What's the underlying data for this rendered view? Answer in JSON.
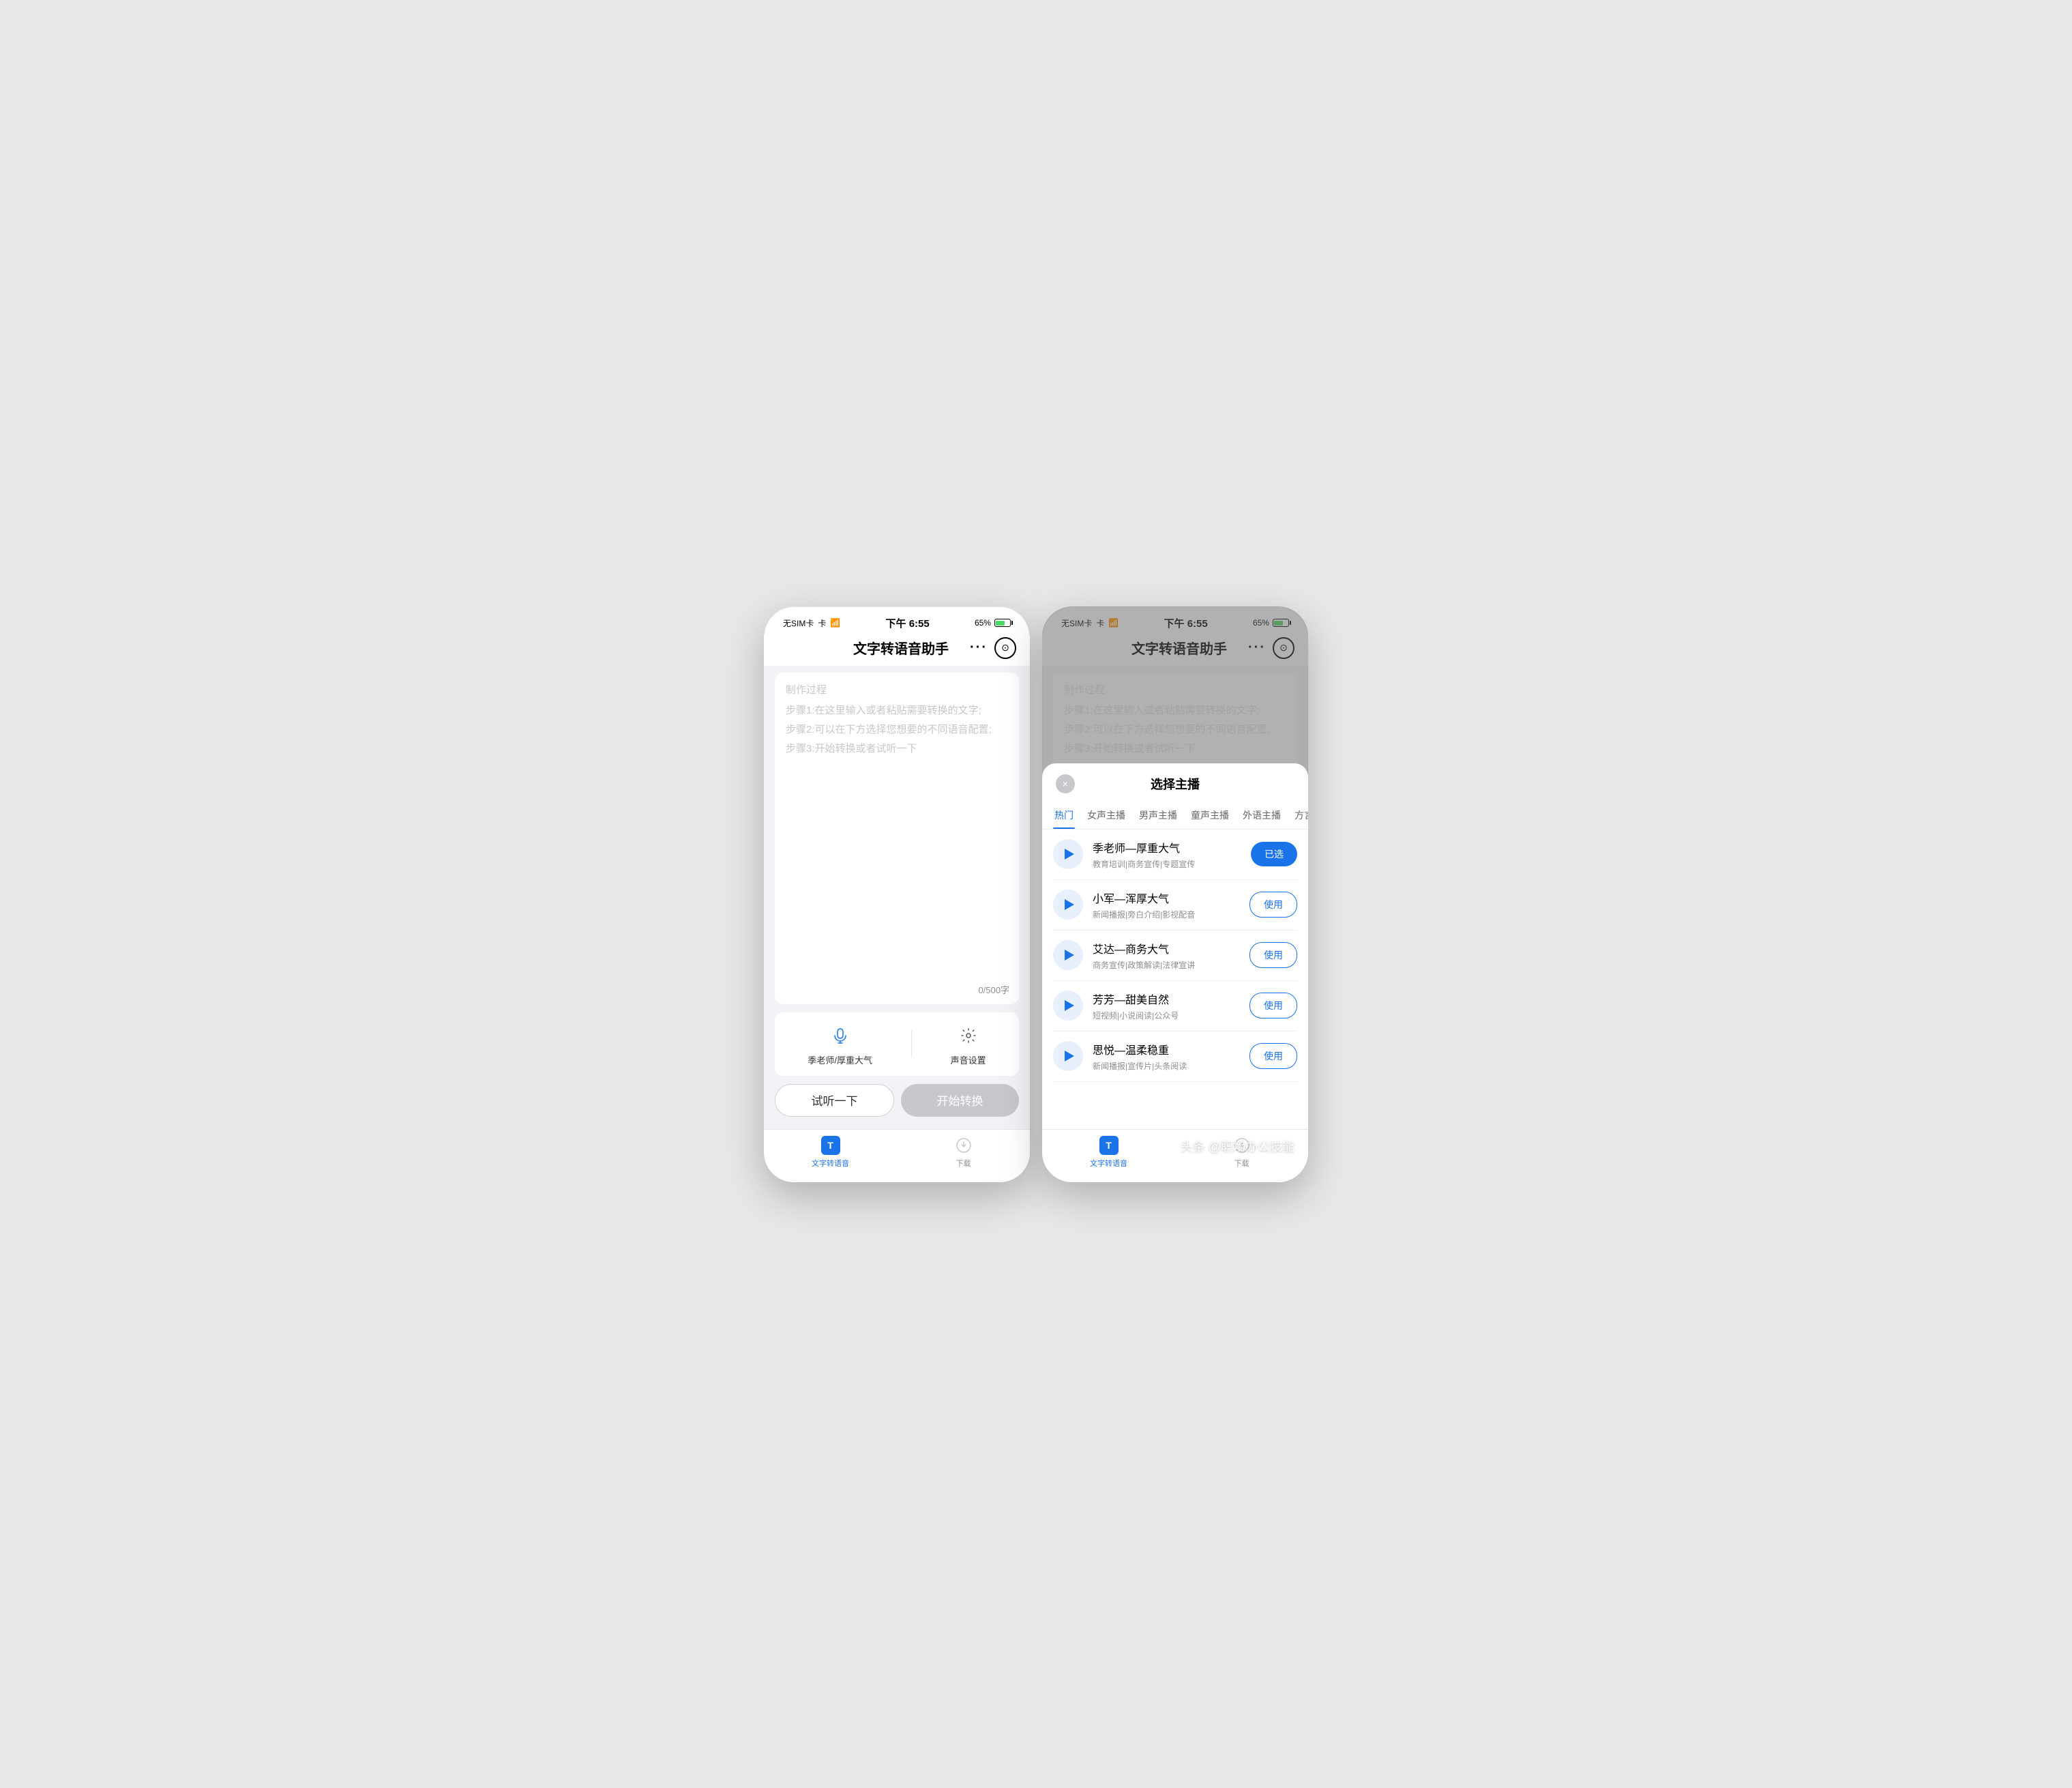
{
  "statusBar": {
    "carrier": "无SIM卡",
    "wifi": "wifi",
    "time": "下午 6:55",
    "battery": "65%"
  },
  "leftPhone": {
    "navTitle": "文字转语音助手",
    "dotsBtnLabel": "···",
    "placeholder": {
      "title": "制作过程",
      "step1": "步骤1:在这里输入或者粘贴需要转换的文字;",
      "step2": "步骤2:可以在下方选择您想要的不同语音配置;",
      "step3": "步骤3:开始转换或者试听一下"
    },
    "charCount": "0/500字",
    "voiceSelector": {
      "label": "季老师/厚重大气",
      "icon": "mic"
    },
    "settingsBtn": {
      "label": "声音设置",
      "icon": "gear"
    },
    "previewBtn": "试听一下",
    "convertBtn": "开始转换",
    "tabs": [
      {
        "id": "tts",
        "label": "文字转语音",
        "active": true
      },
      {
        "id": "download",
        "label": "下载",
        "active": false
      }
    ]
  },
  "rightPhone": {
    "navTitle": "文字转语音助手",
    "dotsBtnLabel": "···",
    "modal": {
      "title": "选择主播",
      "closeBtn": "×",
      "categories": [
        {
          "id": "hot",
          "label": "热门",
          "active": true
        },
        {
          "id": "female",
          "label": "女声主播",
          "active": false
        },
        {
          "id": "male",
          "label": "男声主播",
          "active": false
        },
        {
          "id": "child",
          "label": "童声主播",
          "active": false
        },
        {
          "id": "foreign",
          "label": "外语主播",
          "active": false
        },
        {
          "id": "dialect",
          "label": "方言主播",
          "active": false
        }
      ],
      "voices": [
        {
          "id": 1,
          "name": "季老师—厚重大气",
          "tags": "教育培训|商务宣传|专题宣传",
          "selected": true,
          "btnLabel": "已选"
        },
        {
          "id": 2,
          "name": "小军—浑厚大气",
          "tags": "新闻播报|旁白介绍|影视配音",
          "selected": false,
          "btnLabel": "使用"
        },
        {
          "id": 3,
          "name": "艾达—商务大气",
          "tags": "商务宣传|政策解读|法律宣讲",
          "selected": false,
          "btnLabel": "使用"
        },
        {
          "id": 4,
          "name": "芳芳—甜美自然",
          "tags": "短视频|小说阅读|公众号",
          "selected": false,
          "btnLabel": "使用"
        },
        {
          "id": 5,
          "name": "思悦—温柔稳重",
          "tags": "新闻播报|宣传片|头条阅读",
          "selected": false,
          "btnLabel": "使用"
        }
      ]
    },
    "tabs": [
      {
        "id": "tts",
        "label": "文字转语音",
        "active": true
      },
      {
        "id": "download",
        "label": "下载",
        "active": false
      }
    ]
  },
  "watermark": "头条 @职场办公技能"
}
